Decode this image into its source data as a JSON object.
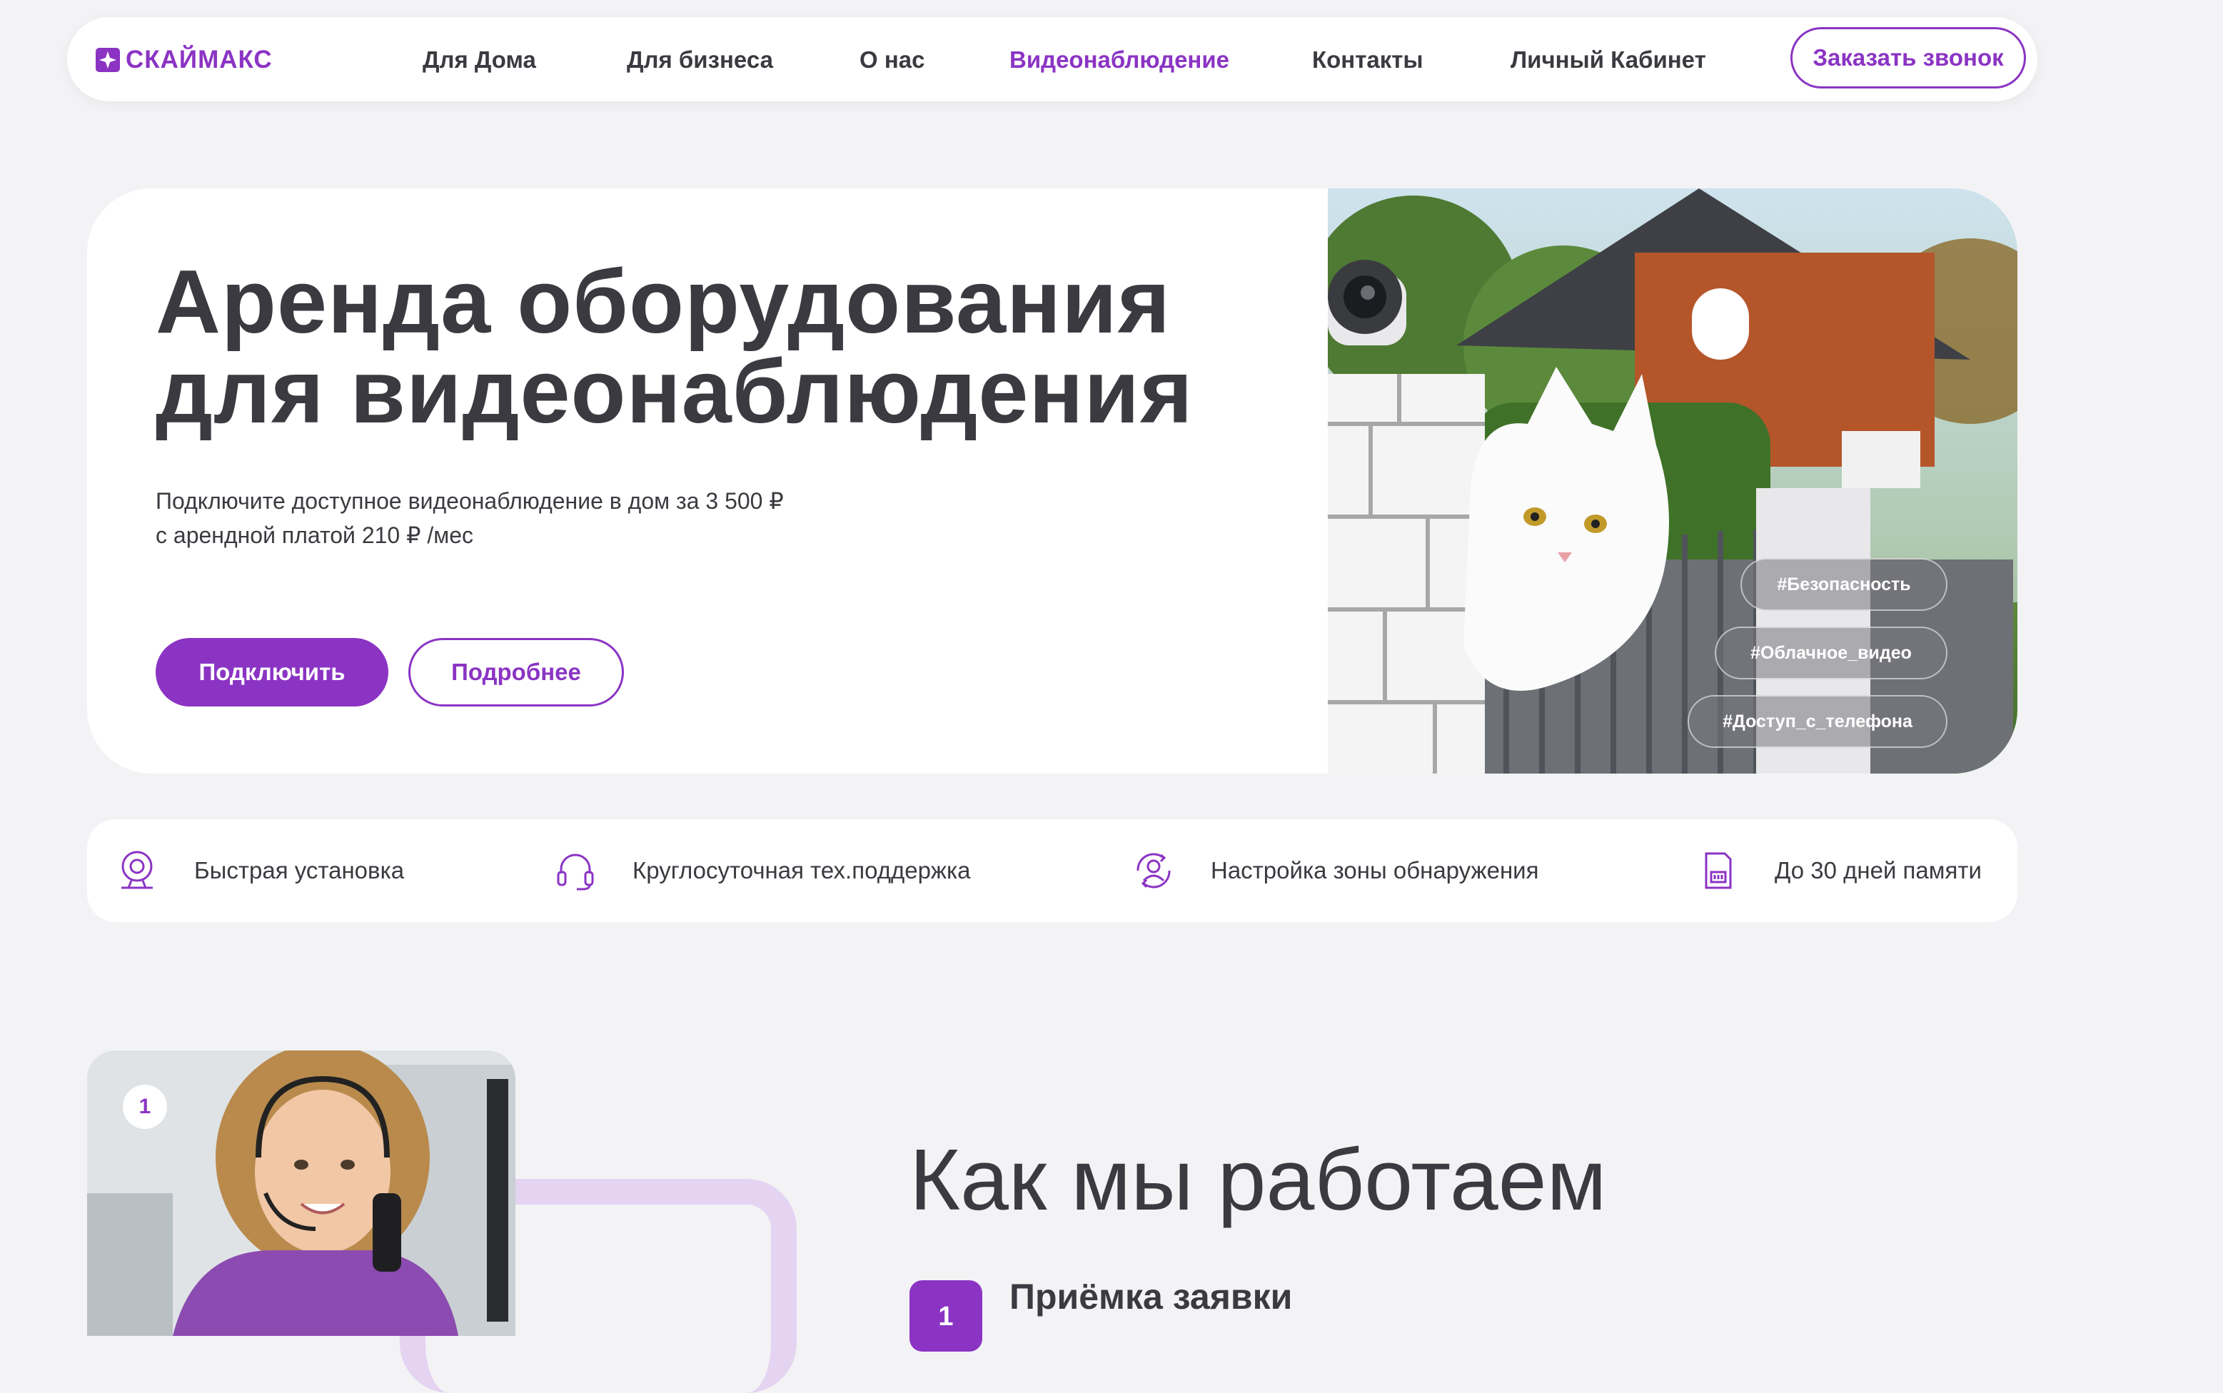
{
  "header": {
    "logo_text": "СКАЙМАКС",
    "nav": [
      {
        "label": "Для Дома"
      },
      {
        "label": "Для бизнеса"
      },
      {
        "label": "О нас"
      },
      {
        "label": "Видеонаблюдение",
        "active": true
      },
      {
        "label": "Контакты"
      },
      {
        "label": "Личный Кабинет"
      }
    ],
    "call_button": "Заказать звонок"
  },
  "hero": {
    "title_line1": "Аренда оборудования",
    "title_line2": "для видеонаблюдения",
    "subtitle_line1": "Подключите доступное видеонаблюдение в дом за 3 500 ₽",
    "subtitle_line2": "с арендной платой 210 ₽ /мес",
    "primary_button": "Подключить",
    "secondary_button": "Подробнее",
    "tags": [
      "#Безопасность",
      "#Облачное_видео",
      "#Доступ_с_телефона"
    ],
    "image_icons": [
      "security-camera-icon",
      "cat-illustration"
    ]
  },
  "features": [
    {
      "icon": "webcam-icon",
      "label": "Быстрая установка"
    },
    {
      "icon": "headset-icon",
      "label": "Круглосуточная тех.поддержка"
    },
    {
      "icon": "detection-zone-icon",
      "label": "Настройка зоны обнаружения"
    },
    {
      "icon": "sd-card-icon",
      "label": "До 30 дней памяти"
    }
  ],
  "how_we_work": {
    "title": "Как мы работаем",
    "photo_badge": "1",
    "steps": [
      {
        "number": "1",
        "title": "Приёмка заявки"
      }
    ]
  },
  "colors": {
    "accent": "#8b34c4",
    "text": "#3b3a40",
    "page_bg": "#f3f3f5",
    "lavender": "#e4d3f1"
  }
}
